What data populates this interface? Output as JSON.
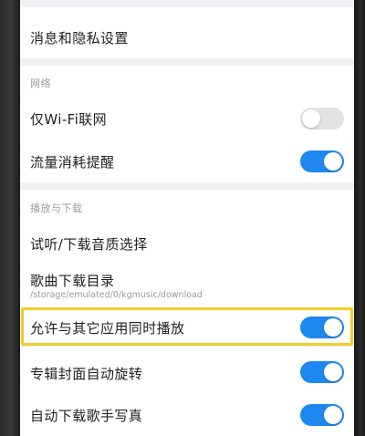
{
  "settings": {
    "privacy_row": "消息和隐私设置",
    "network_section": "网络",
    "wifi_only_label": "仅Wi-Fi联网",
    "wifi_only_on": false,
    "data_usage_label": "流量消耗提醒",
    "data_usage_on": true,
    "download_section": "播放与下载",
    "audio_quality_label": "试听/下载音质选择",
    "download_dir_label": "歌曲下载目录",
    "download_dir_path": "/storage/emulated/0/kgmusic/download",
    "concurrent_play_label": "允许与其它应用同时播放",
    "concurrent_play_on": true,
    "album_rotate_label": "专辑封面自动旋转",
    "album_rotate_on": true,
    "artist_photo_label": "自动下载歌手写真",
    "artist_photo_on": true
  },
  "colors": {
    "accent": "#1e88f0",
    "highlight": "#f2cc28",
    "toggle_off": "#e2e2e4"
  }
}
